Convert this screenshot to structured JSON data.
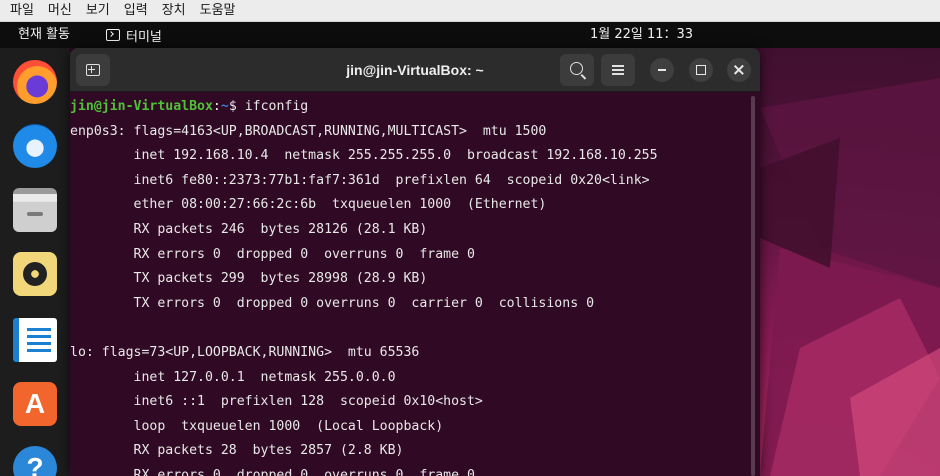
{
  "vbox_menu": [
    "파일",
    "머신",
    "보기",
    "입력",
    "장치",
    "도움말"
  ],
  "topbar": {
    "activities": "현재 활동",
    "app_name": "터미널",
    "clock": "1월 22일  11：33"
  },
  "dock": {
    "apps": [
      {
        "name": "Firefox",
        "icon": "firefox-icon"
      },
      {
        "name": "Thunderbird",
        "icon": "thunderbird-icon"
      },
      {
        "name": "Files",
        "icon": "files-icon"
      },
      {
        "name": "Rhythmbox",
        "icon": "rhythmbox-icon"
      },
      {
        "name": "LibreOffice Writer",
        "icon": "writer-icon"
      },
      {
        "name": "Ubuntu Software",
        "icon": "software-icon",
        "glyph": "A"
      },
      {
        "name": "Help",
        "icon": "help-icon",
        "glyph": "?"
      }
    ]
  },
  "terminal": {
    "title": "jin@jin-VirtualBox: ~",
    "prompt_user": "jin@jin-VirtualBox",
    "prompt_sep": ":",
    "prompt_path": "~",
    "prompt_symbol": "$ ",
    "command": "ifconfig",
    "lines": [
      "enp0s3: flags=4163<UP,BROADCAST,RUNNING,MULTICAST>  mtu 1500",
      "        inet 192.168.10.4  netmask 255.255.255.0  broadcast 192.168.10.255",
      "        inet6 fe80::2373:77b1:faf7:361d  prefixlen 64  scopeid 0x20<link>",
      "        ether 08:00:27:66:2c:6b  txqueuelen 1000  (Ethernet)",
      "        RX packets 246  bytes 28126 (28.1 KB)",
      "        RX errors 0  dropped 0  overruns 0  frame 0",
      "        TX packets 299  bytes 28998 (28.9 KB)",
      "        TX errors 0  dropped 0 overruns 0  carrier 0  collisions 0",
      "",
      "lo: flags=73<UP,LOOPBACK,RUNNING>  mtu 65536",
      "        inet 127.0.0.1  netmask 255.0.0.0",
      "        inet6 ::1  prefixlen 128  scopeid 0x10<host>",
      "        loop  txqueuelen 1000  (Local Loopback)",
      "        RX packets 28  bytes 2857 (2.8 KB)",
      "        RX errors 0  dropped 0  overruns 0  frame 0"
    ]
  },
  "colors": {
    "terminal_bg": "#300a24",
    "prompt_user": "#4ec136",
    "prompt_path": "#3a78d6",
    "headerbar": "#2c2c2c"
  }
}
